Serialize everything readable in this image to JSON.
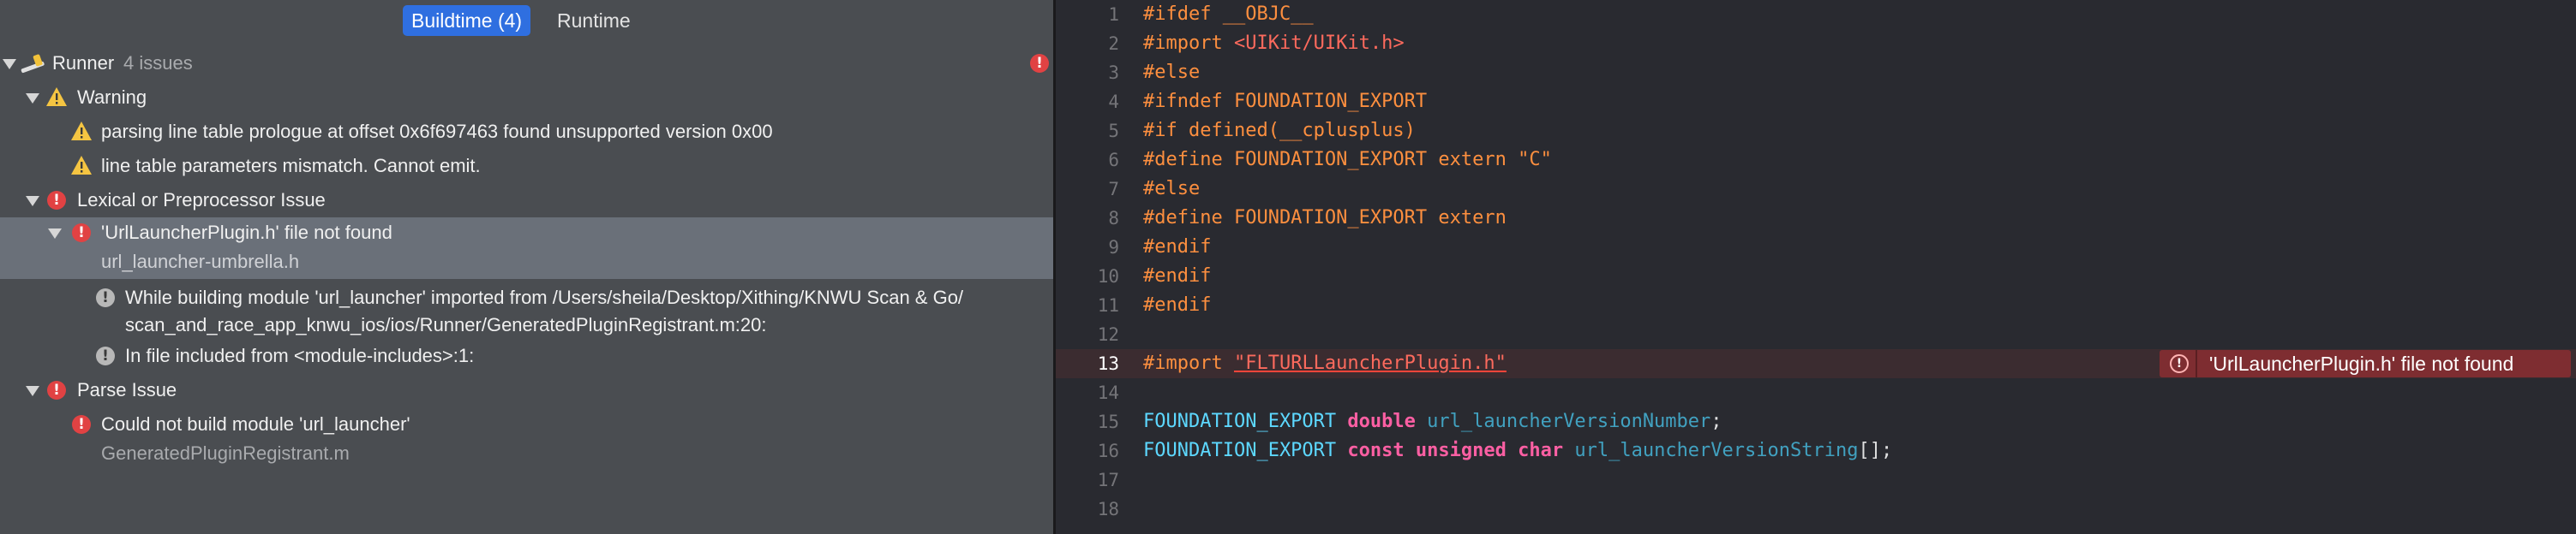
{
  "scope_tabs": [
    {
      "label": "Buildtime (4)",
      "active": true
    },
    {
      "label": "Runtime",
      "active": false
    }
  ],
  "issues": {
    "project": {
      "name": "Runner",
      "count": "4 issues"
    },
    "warning_group": {
      "title": "Warning",
      "items": [
        "parsing line table prologue at offset 0x6f697463 found unsupported version 0x00",
        "line table parameters mismatch. Cannot emit."
      ]
    },
    "lexical_group": {
      "title": "Lexical or Preprocessor Issue",
      "error": {
        "title": "'UrlLauncherPlugin.h' file not found",
        "file": "url_launcher-umbrella.h"
      },
      "notes": [
        {
          "line1": "While building module 'url_launcher' imported from /Users/sheila/Desktop/Xithing/KNWU Scan & Go/",
          "line2": "scan_and_race_app_knwu_ios/ios/Runner/GeneratedPluginRegistrant.m:20:"
        },
        {
          "line1": "In file included from <module-includes>:1:"
        }
      ]
    },
    "parse_group": {
      "title": "Parse Issue",
      "error": {
        "title": "Could not build module 'url_launcher'",
        "file": "GeneratedPluginRegistrant.m"
      }
    }
  },
  "editor": {
    "line_numbers": [
      "1",
      "2",
      "3",
      "4",
      "5",
      "6",
      "7",
      "8",
      "9",
      "10",
      "11",
      "12",
      "13",
      "14",
      "15",
      "16",
      "17",
      "18"
    ],
    "lines": {
      "l1": "#ifdef __OBJC__",
      "l2a": "#import ",
      "l2b": "<UIKit/UIKit.h>",
      "l3": "#else",
      "l4": "#ifndef FOUNDATION_EXPORT",
      "l5": "#if defined(__cplusplus)",
      "l6a": "#define FOUNDATION_EXPORT extern ",
      "l6b": "\"C\"",
      "l7": "#else",
      "l8": "#define FOUNDATION_EXPORT extern",
      "l9": "#endif",
      "l10": "#endif",
      "l11": "#endif",
      "l13a": "#import ",
      "l13b": "\"FLTURLLauncherPlugin.h\"",
      "l15a": "FOUNDATION_EXPORT",
      "l15b": "double",
      "l15c": "url_launcherVersionNumber",
      "l15d": ";",
      "l16a": "FOUNDATION_EXPORT",
      "l16b": "const",
      "l16c": "unsigned",
      "l16d": "char",
      "l16e": "url_launcherVersionString",
      "l16f": "[];"
    },
    "inline_error": "'UrlLauncherPlugin.h' file not found"
  },
  "colors": {
    "accent": "#2f6fe0",
    "error": "#e14243",
    "warning": "#f5c542",
    "preprocessor": "#fd8f3f",
    "string": "#fc6a5d",
    "keyword": "#fc5fa3"
  },
  "icons": {
    "project": "hammer-icon",
    "warning": "warning-triangle-icon",
    "error": "error-circle-icon",
    "note": "note-circle-icon"
  }
}
